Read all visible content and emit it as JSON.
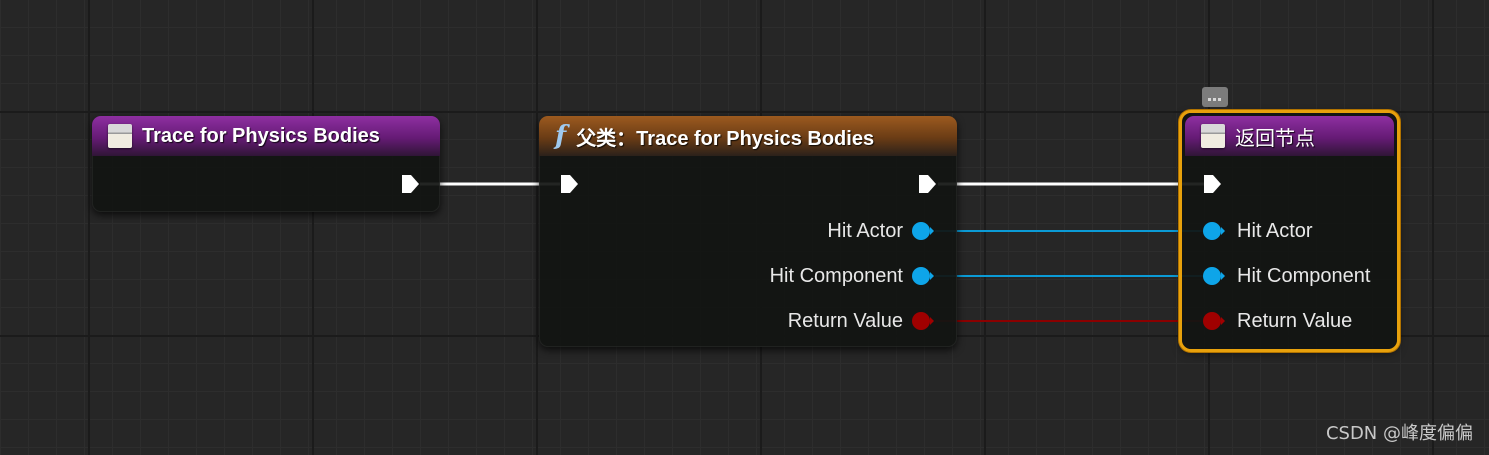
{
  "graph": {
    "wire_colors": {
      "exec": "#ffffff",
      "object": "#0b9bd6",
      "bool": "#8b0000"
    }
  },
  "nodes": {
    "event": {
      "title": "Trace for Physics Bodies",
      "header_color": "#7a2490"
    },
    "parent_call": {
      "title": "父类：Trace for Physics Bodies",
      "header_color": "#8a4f1c",
      "outputs": [
        "Hit Actor",
        "Hit Component",
        "Return Value"
      ]
    },
    "return_node": {
      "title": "返回节点",
      "header_color": "#7a2490",
      "selected_border_color": "#e8a10c",
      "inputs": [
        "Hit Actor",
        "Hit Component",
        "Return Value"
      ]
    }
  },
  "pin_colors": {
    "object": "#0ea5e9",
    "bool": "#a00000",
    "exec": "#ffffff"
  },
  "watermark": "CSDN @峰度偏偏"
}
